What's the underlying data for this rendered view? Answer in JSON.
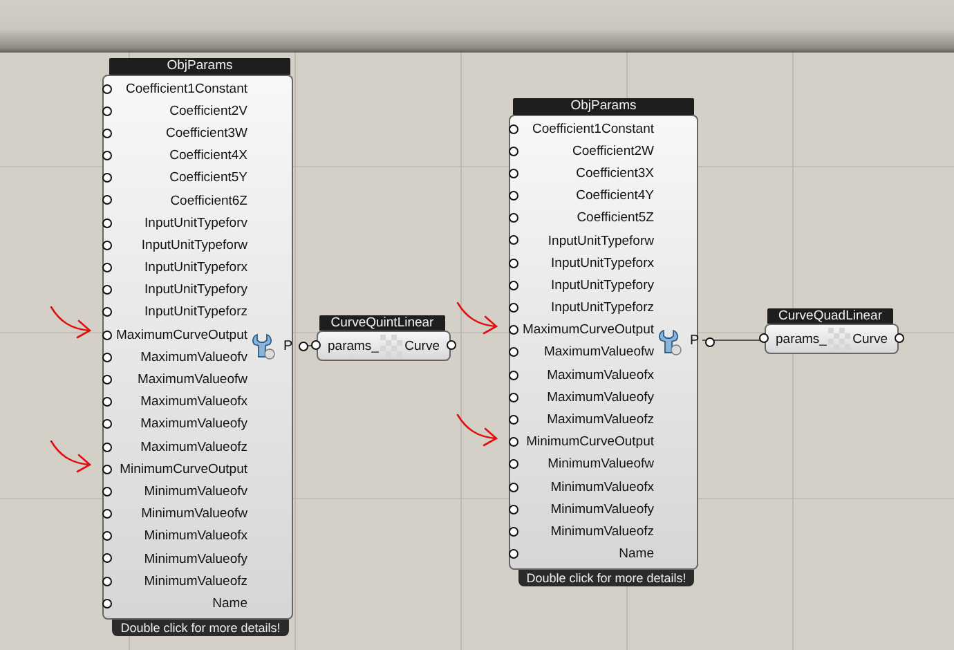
{
  "nodes": [
    {
      "kind": "params",
      "title": "ObjParams",
      "output": "P",
      "footer": "Double click for more details!",
      "inputs": [
        {
          "name": "Coefficient1Constant",
          "annotated": false
        },
        {
          "name": "Coefficient2V",
          "annotated": false
        },
        {
          "name": "Coefficient3W",
          "annotated": false
        },
        {
          "name": "Coefficient4X",
          "annotated": false
        },
        {
          "name": "Coefficient5Y",
          "annotated": false
        },
        {
          "name": "Coefficient6Z",
          "annotated": false
        },
        {
          "name": "InputUnitTypeforv",
          "annotated": false
        },
        {
          "name": "InputUnitTypeforw",
          "annotated": false
        },
        {
          "name": "InputUnitTypeforx",
          "annotated": false
        },
        {
          "name": "InputUnitTypefory",
          "annotated": false
        },
        {
          "name": "InputUnitTypeforz",
          "annotated": false
        },
        {
          "name": "MaximumCurveOutput",
          "annotated": true
        },
        {
          "name": "MaximumValueofv",
          "annotated": false
        },
        {
          "name": "MaximumValueofw",
          "annotated": false
        },
        {
          "name": "MaximumValueofx",
          "annotated": false
        },
        {
          "name": "MaximumValueofy",
          "annotated": false
        },
        {
          "name": "MaximumValueofz",
          "annotated": false
        },
        {
          "name": "MinimumCurveOutput",
          "annotated": true
        },
        {
          "name": "MinimumValueofv",
          "annotated": false
        },
        {
          "name": "MinimumValueofw",
          "annotated": false
        },
        {
          "name": "MinimumValueofx",
          "annotated": false
        },
        {
          "name": "MinimumValueofy",
          "annotated": false
        },
        {
          "name": "MinimumValueofz",
          "annotated": false
        },
        {
          "name": "Name",
          "annotated": false
        }
      ]
    },
    {
      "kind": "component",
      "title": "CurveQuintLinear",
      "input": "params_",
      "output": "Curve"
    },
    {
      "kind": "params",
      "title": "ObjParams",
      "output": "P",
      "footer": "Double click for more details!",
      "inputs": [
        {
          "name": "Coefficient1Constant",
          "annotated": false
        },
        {
          "name": "Coefficient2W",
          "annotated": false
        },
        {
          "name": "Coefficient3X",
          "annotated": false
        },
        {
          "name": "Coefficient4Y",
          "annotated": false
        },
        {
          "name": "Coefficient5Z",
          "annotated": false
        },
        {
          "name": "InputUnitTypeforw",
          "annotated": false
        },
        {
          "name": "InputUnitTypeforx",
          "annotated": false
        },
        {
          "name": "InputUnitTypefory",
          "annotated": false
        },
        {
          "name": "InputUnitTypeforz",
          "annotated": false
        },
        {
          "name": "MaximumCurveOutput",
          "annotated": true
        },
        {
          "name": "MaximumValueofw",
          "annotated": false
        },
        {
          "name": "MaximumValueofx",
          "annotated": false
        },
        {
          "name": "MaximumValueofy",
          "annotated": false
        },
        {
          "name": "MaximumValueofz",
          "annotated": false
        },
        {
          "name": "MinimumCurveOutput",
          "annotated": true
        },
        {
          "name": "MinimumValueofw",
          "annotated": false
        },
        {
          "name": "MinimumValueofx",
          "annotated": false
        },
        {
          "name": "MinimumValueofy",
          "annotated": false
        },
        {
          "name": "MinimumValueofz",
          "annotated": false
        },
        {
          "name": "Name",
          "annotated": false
        }
      ]
    },
    {
      "kind": "component",
      "title": "CurveQuadLinear",
      "input": "params_",
      "output": "Curve"
    }
  ]
}
